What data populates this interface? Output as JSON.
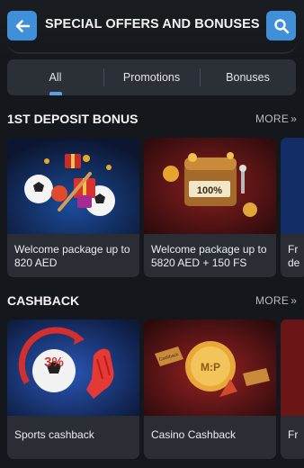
{
  "header": {
    "title": "SPECIAL OFFERS AND BONUSES",
    "back_icon": "arrow-left-icon",
    "search_icon": "search-icon",
    "accent": "#3f8fd9"
  },
  "tabs": [
    {
      "label": "All",
      "active": true
    },
    {
      "label": "Promotions",
      "active": false
    },
    {
      "label": "Bonuses",
      "active": false
    }
  ],
  "sections": [
    {
      "title": "1ST DEPOSIT BONUS",
      "more": "MORE",
      "cards": [
        {
          "label": "Welcome package up to 820 AED"
        },
        {
          "label": "Welcome package up to 5820 AED + 150 FS"
        },
        {
          "label": "Fr de"
        }
      ]
    },
    {
      "title": "CASHBACK",
      "more": "MORE",
      "cards": [
        {
          "label": "Sports cashback",
          "badge": "3%"
        },
        {
          "label": "Casino Cashback",
          "badge": "M:P",
          "ribbon": "Cashback"
        },
        {
          "label": "Fr"
        }
      ]
    }
  ],
  "slot_reel": "100%",
  "colors": {
    "background": "#14171c",
    "card": "#2a2d33",
    "tab_bar": "#2b2f36"
  }
}
